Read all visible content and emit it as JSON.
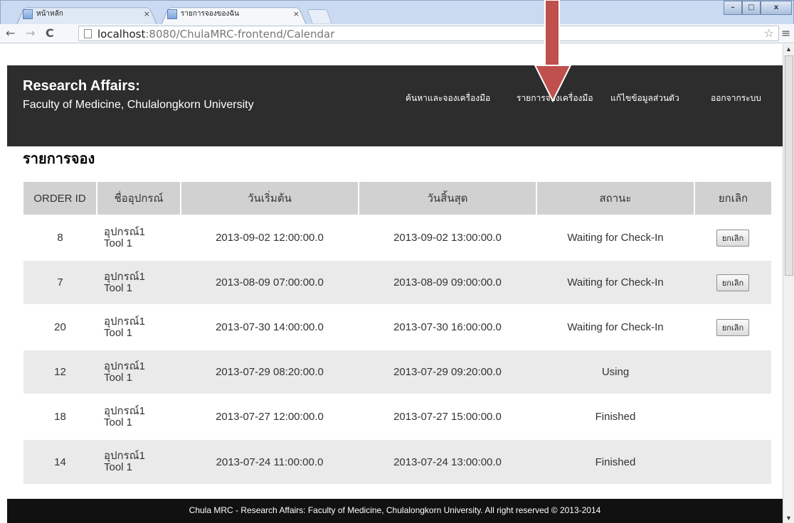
{
  "browser": {
    "tabs": [
      {
        "label": "หน้าหลัก",
        "close": "×"
      },
      {
        "label": "รายการจองของฉัน",
        "close": "×"
      }
    ],
    "window_controls": {
      "minimize": "–",
      "maximize": "□",
      "close": "x"
    },
    "url_host": "localhost",
    "url_rest": ":8080/ChulaMRC-frontend/Calendar",
    "back": "←",
    "forward": "→",
    "reload": "C",
    "star": "☆",
    "menu": "≡"
  },
  "header": {
    "title": "Research Affairs:",
    "subtitle": "Faculty of Medicine, Chulalongkorn University",
    "nav": [
      {
        "label": "ค้นหาและจองเครื่องมือ"
      },
      {
        "label": "รายการจองเครื่องมือ"
      },
      {
        "label": "แก้ไขข้อมูลส่วนตัว"
      },
      {
        "label": "ออกจากระบบ"
      }
    ]
  },
  "page": {
    "heading": "รายการจอง"
  },
  "table": {
    "columns": [
      "ORDER ID",
      "ชื่ออุปกรณ์",
      "วันเริ่มต้น",
      "วันสิ้นสุด",
      "สถานะ",
      "ยกเลิก"
    ],
    "cancel_label": "ยกเลิก",
    "rows": [
      {
        "id": "8",
        "tool_th": "อุปกรณ์1",
        "tool_en": "Tool 1",
        "start": "2013-09-02 12:00:00.0",
        "end": "2013-09-02 13:00:00.0",
        "status": "Waiting for Check-In",
        "cancel": "ยกเลิก"
      },
      {
        "id": "7",
        "tool_th": "อุปกรณ์1",
        "tool_en": "Tool 1",
        "start": "2013-08-09 07:00:00.0",
        "end": "2013-08-09 09:00:00.0",
        "status": "Waiting for Check-In",
        "cancel": "ยกเลิก"
      },
      {
        "id": "20",
        "tool_th": "อุปกรณ์1",
        "tool_en": "Tool 1",
        "start": "2013-07-30 14:00:00.0",
        "end": "2013-07-30 16:00:00.0",
        "status": "Waiting for Check-In",
        "cancel": "ยกเลิก"
      },
      {
        "id": "12",
        "tool_th": "อุปกรณ์1",
        "tool_en": "Tool 1",
        "start": "2013-07-29 08:20:00.0",
        "end": "2013-07-29 09:20:00.0",
        "status": "Using",
        "cancel": ""
      },
      {
        "id": "18",
        "tool_th": "อุปกรณ์1",
        "tool_en": "Tool 1",
        "start": "2013-07-27 12:00:00.0",
        "end": "2013-07-27 15:00:00.0",
        "status": "Finished",
        "cancel": ""
      },
      {
        "id": "14",
        "tool_th": "อุปกรณ์1",
        "tool_en": "Tool 1",
        "start": "2013-07-24 11:00:00.0",
        "end": "2013-07-24 13:00:00.0",
        "status": "Finished",
        "cancel": ""
      }
    ]
  },
  "footer": {
    "text": "Chula MRC - Research Affairs: Faculty of Medicine, Chulalongkorn University. All right reserved © 2013-2014"
  },
  "colors": {
    "header_bg": "#2d2d2d",
    "footer_bg": "#111111",
    "annotation_arrow": "#c0504d"
  }
}
